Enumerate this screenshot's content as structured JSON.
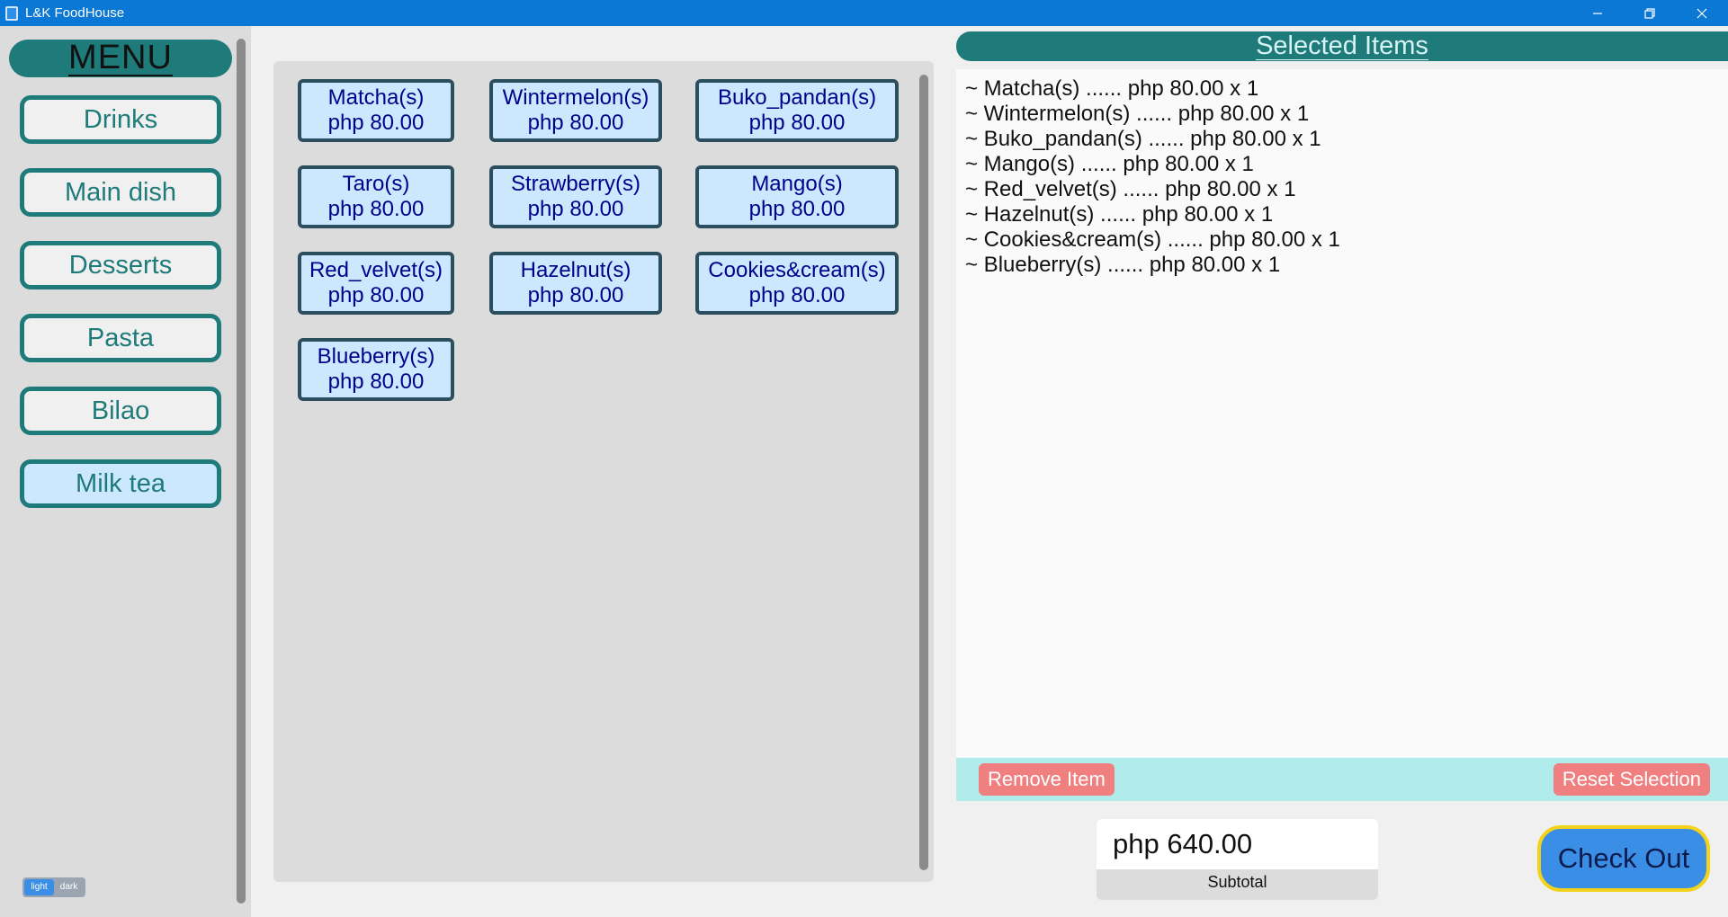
{
  "window": {
    "title": "L&K FoodHouse",
    "controls": [
      "minimize-icon",
      "restore-icon",
      "close-icon"
    ]
  },
  "sidebar": {
    "header": "MENU",
    "categories": [
      {
        "label": "Drinks"
      },
      {
        "label": "Main dish"
      },
      {
        "label": "Desserts"
      },
      {
        "label": "Pasta"
      },
      {
        "label": "Bilao"
      },
      {
        "label": "Milk tea"
      }
    ],
    "active_category": "Milk tea",
    "theme_toggle": {
      "light": "light",
      "dark": "dark",
      "selected": "light"
    }
  },
  "products": [
    {
      "name": "Matcha(s)",
      "price": "php 80.00"
    },
    {
      "name": "Wintermelon(s)",
      "price": "php 80.00"
    },
    {
      "name": "Buko_pandan(s)",
      "price": "php 80.00"
    },
    {
      "name": "Taro(s)",
      "price": "php 80.00"
    },
    {
      "name": "Strawberry(s)",
      "price": "php 80.00"
    },
    {
      "name": "Mango(s)",
      "price": "php 80.00"
    },
    {
      "name": "Red_velvet(s)",
      "price": "php 80.00"
    },
    {
      "name": "Hazelnut(s)",
      "price": "php 80.00"
    },
    {
      "name": "Cookies&cream(s)",
      "price": "php 80.00"
    },
    {
      "name": "Blueberry(s)",
      "price": "php 80.00"
    }
  ],
  "selected": {
    "title": "Selected Items",
    "items": [
      "~ Matcha(s) ...... php 80.00 x 1",
      "~ Wintermelon(s) ...... php 80.00 x 1",
      "~ Buko_pandan(s) ...... php 80.00 x 1",
      "~ Mango(s) ...... php 80.00 x 1",
      "~ Red_velvet(s) ...... php 80.00 x 1",
      "~ Hazelnut(s) ...... php 80.00 x 1",
      "~ Cookies&cream(s) ...... php 80.00 x 1",
      "~ Blueberry(s) ...... php 80.00 x 1"
    ],
    "remove_label": "Remove Item",
    "reset_label": "Reset Selection"
  },
  "subtotal": {
    "value": "php 640.00",
    "label": "Subtotal"
  },
  "checkout_label": "Check Out",
  "colors": {
    "titlebar": "#0a78d4",
    "teal": "#1f7a7a",
    "button_fill": "#cce8ff",
    "product_text": "#00008b",
    "action_bar": "#b0ecec",
    "action_button": "#f08080",
    "checkout_border": "#f2d21a",
    "checkout_fill": "#3a8ee6"
  }
}
